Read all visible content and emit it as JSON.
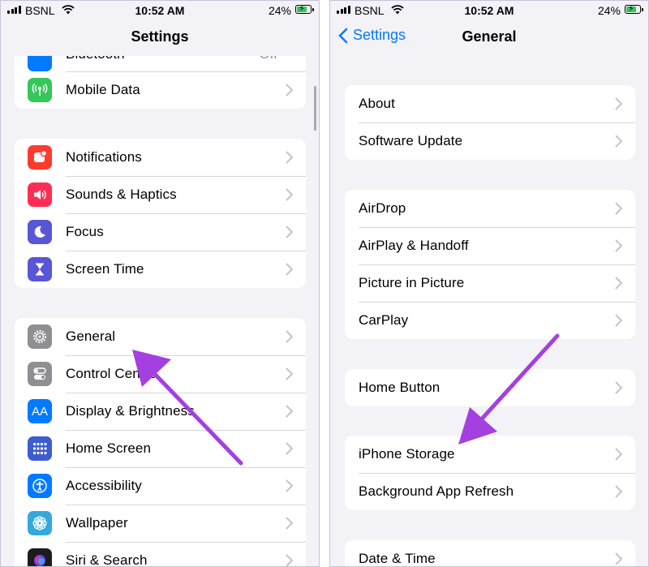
{
  "left": {
    "status": {
      "carrier": "BSNL",
      "time": "10:52 AM",
      "battery": "24%"
    },
    "nav": {
      "title": "Settings"
    },
    "top_partial": {
      "label": "Bluetooth",
      "value": "Off"
    },
    "group1": [
      {
        "label": "Mobile Data",
        "icon": "antenna-icon",
        "color": "#34c759"
      }
    ],
    "group2": [
      {
        "label": "Notifications",
        "icon": "bell-icon",
        "color": "#ff3b30"
      },
      {
        "label": "Sounds & Haptics",
        "icon": "speaker-icon",
        "color": "#ff2d55"
      },
      {
        "label": "Focus",
        "icon": "moon-icon",
        "color": "#5856d6"
      },
      {
        "label": "Screen Time",
        "icon": "hourglass-icon",
        "color": "#5856d6"
      }
    ],
    "group3": [
      {
        "label": "General",
        "icon": "gear-icon",
        "color": "#8e8e93"
      },
      {
        "label": "Control Centre",
        "icon": "toggles-icon",
        "color": "#8e8e93"
      },
      {
        "label": "Display & Brightness",
        "icon": "text-size-icon",
        "glyph": "AA",
        "color": "#007aff"
      },
      {
        "label": "Home Screen",
        "icon": "app-grid-icon",
        "color": "#3d5ccf"
      },
      {
        "label": "Accessibility",
        "icon": "accessibility-icon",
        "color": "#007aff"
      },
      {
        "label": "Wallpaper",
        "icon": "flower-icon",
        "color": "#34aadc"
      },
      {
        "label": "Siri & Search",
        "icon": "siri-icon",
        "color": "#1c1c1e"
      }
    ]
  },
  "right": {
    "status": {
      "carrier": "BSNL",
      "time": "10:52 AM",
      "battery": "24%"
    },
    "nav": {
      "back_label": "Settings",
      "title": "General"
    },
    "group1": [
      "About",
      "Software Update"
    ],
    "group2": [
      "AirDrop",
      "AirPlay & Handoff",
      "Picture in Picture",
      "CarPlay"
    ],
    "group3": [
      "Home Button"
    ],
    "group4": [
      "iPhone Storage",
      "Background App Refresh"
    ],
    "group5": [
      "Date & Time"
    ]
  },
  "annotation": {
    "arrow_color": "#a43fe0"
  }
}
